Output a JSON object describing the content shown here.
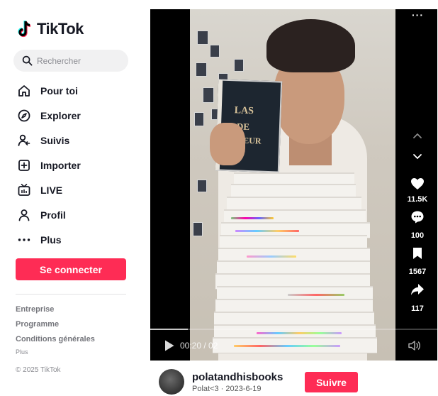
{
  "brand": {
    "name": "TikTok"
  },
  "search": {
    "placeholder": "Rechercher"
  },
  "nav": [
    {
      "label": "Pour toi",
      "icon": "home-icon"
    },
    {
      "label": "Explorer",
      "icon": "compass-icon"
    },
    {
      "label": "Suivis",
      "icon": "following-icon"
    },
    {
      "label": "Importer",
      "icon": "upload-plus-icon"
    },
    {
      "label": "LIVE",
      "icon": "live-tv-icon"
    },
    {
      "label": "Profil",
      "icon": "profile-icon"
    },
    {
      "label": "Plus",
      "icon": "more-dots-icon"
    }
  ],
  "login_label": "Se connecter",
  "footer": {
    "links": [
      "Entreprise",
      "Programme",
      "Conditions générales"
    ],
    "more": "Plus",
    "copyright": "© 2025 TikTok"
  },
  "video": {
    "time": "00:20 / 02",
    "progress": 0.13,
    "book_title": [
      "LAS",
      "DE",
      "COEUR"
    ],
    "likes": "11.5K",
    "comments": "100",
    "saves": "1567",
    "shares": "117",
    "top_dots": "···"
  },
  "author": {
    "username": "polatandhisbooks",
    "subline": "Polat<3 · 2023-6-19",
    "follow_label": "Suivre"
  },
  "colors": {
    "accent": "#fe2c55",
    "text": "#161823"
  }
}
